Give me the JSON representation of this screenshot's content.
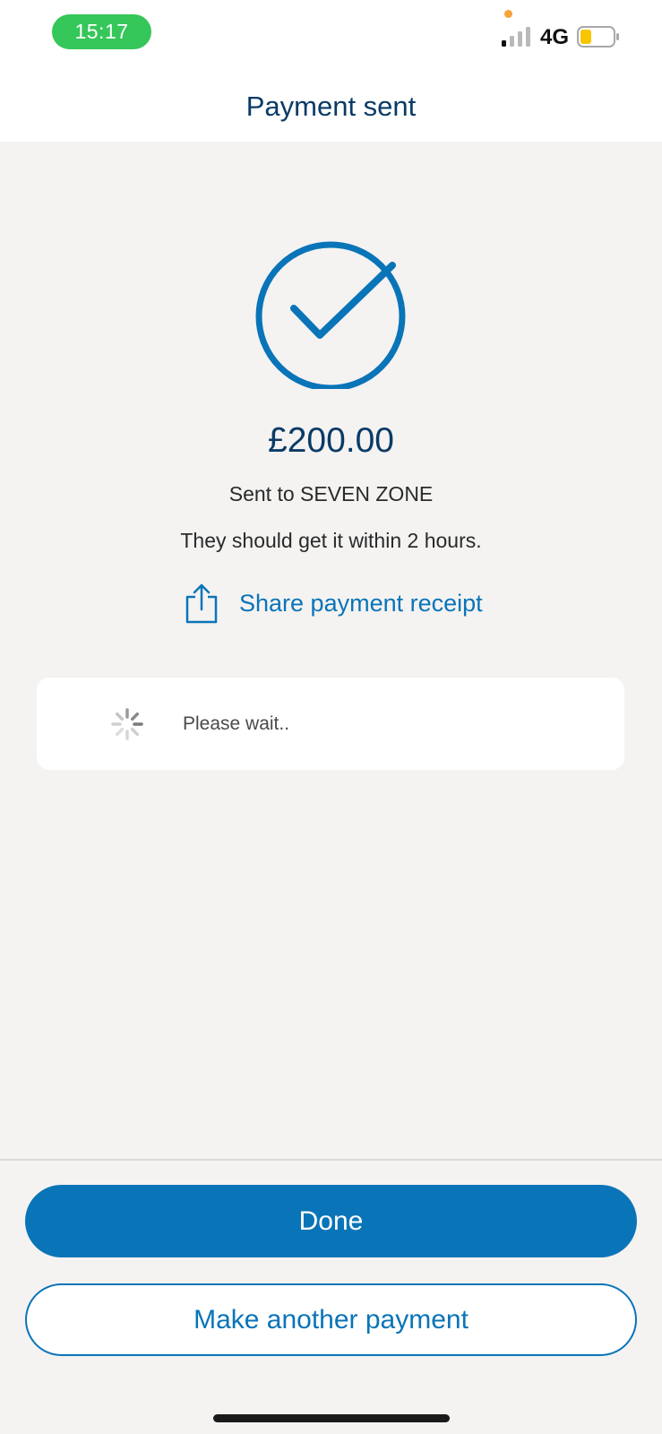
{
  "status_bar": {
    "time": "15:17",
    "network": "4G",
    "pill_color": "#35c759",
    "battery_color": "#f7c600"
  },
  "header": {
    "title": "Payment sent"
  },
  "confirmation": {
    "icon": "checkmark-circle-icon",
    "amount": "£200.00",
    "sent_to": "Sent to SEVEN ZONE",
    "timing": "They should get it within 2 hours."
  },
  "share": {
    "icon": "share-icon",
    "label": "Share payment receipt"
  },
  "wait_card": {
    "icon": "spinner-icon",
    "text": "Please wait.."
  },
  "buttons": {
    "done_label": "Done",
    "another_label": "Make another payment"
  },
  "colors": {
    "accent": "#0a74b8",
    "title": "#0a3b66",
    "background": "#f4f3f2"
  }
}
